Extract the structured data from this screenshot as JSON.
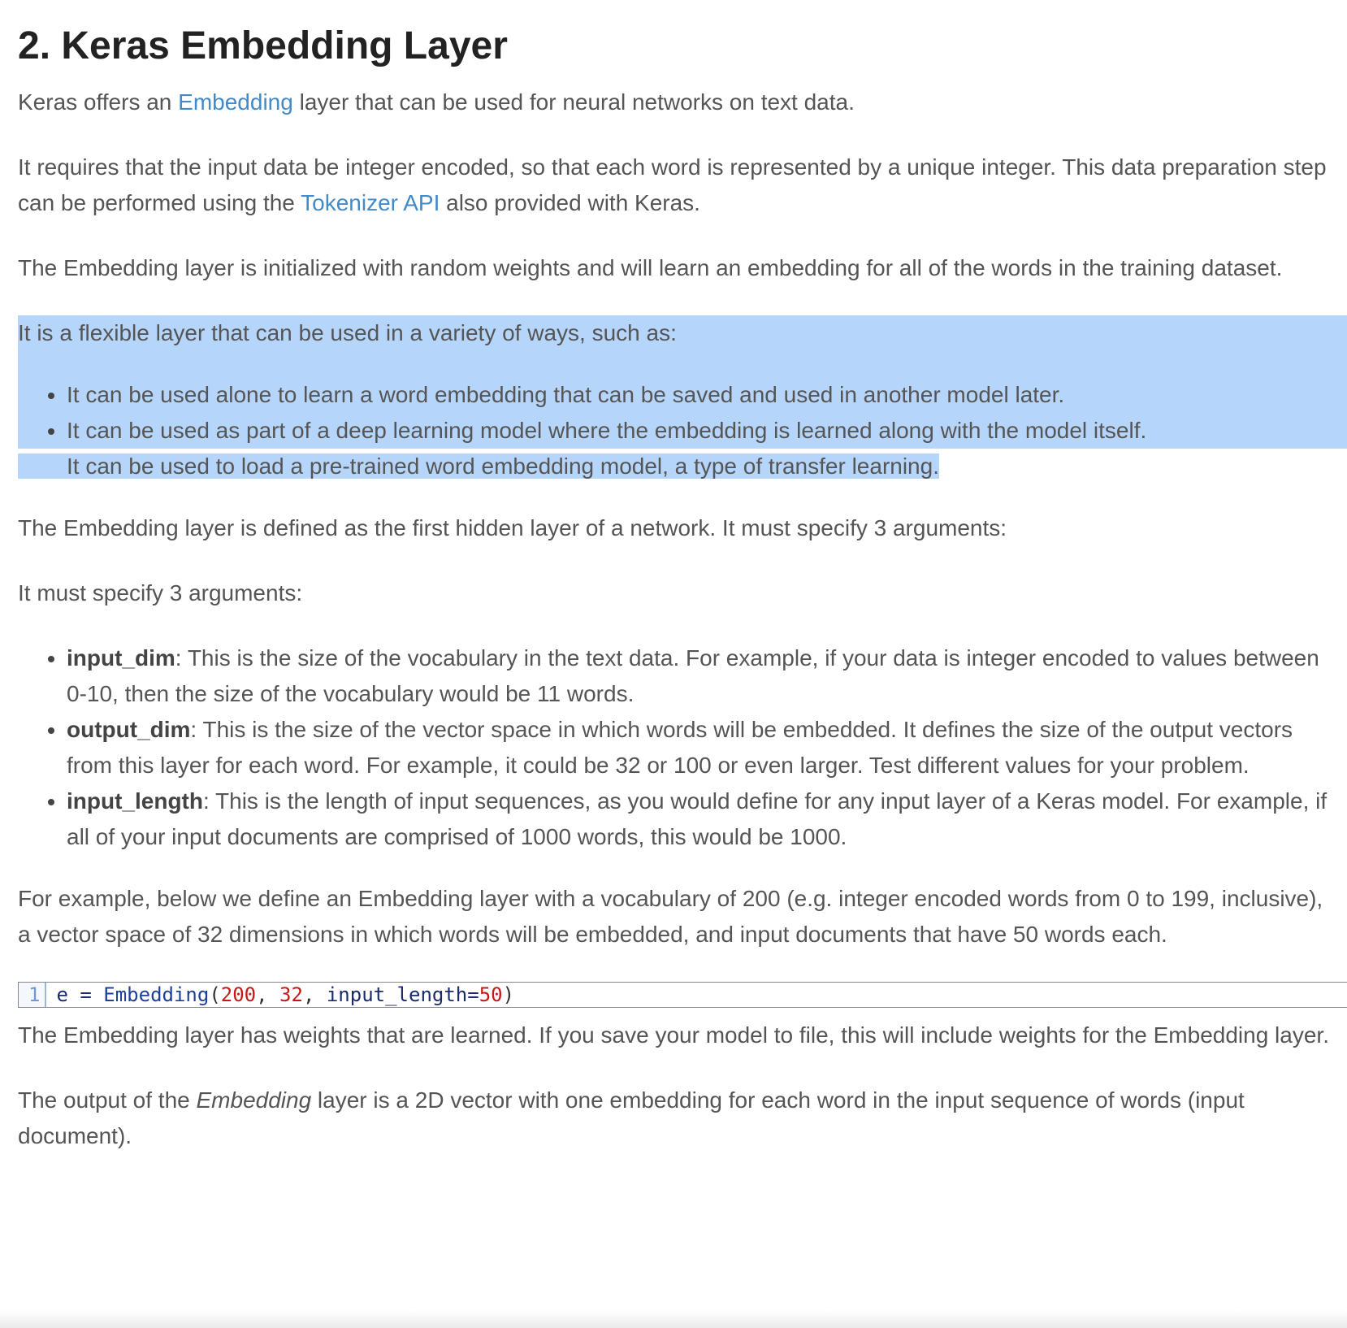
{
  "heading": "2. Keras Embedding Layer",
  "p1": {
    "before": "Keras offers an ",
    "link": "Embedding",
    "after": " layer that can be used for neural networks on text data."
  },
  "p2": {
    "before": "It requires that the input data be integer encoded, so that each word is represented by a unique integer. This data preparation step can be performed using the ",
    "link": "Tokenizer API",
    "after": " also provided with Keras."
  },
  "p3": "The Embedding layer is initialized with random weights and will learn an embedding for all of the words in the training dataset.",
  "p4": "It is a flexible layer that can be used in a variety of ways, such as:",
  "uses": [
    "It can be used alone to learn a word embedding that can be saved and used in another model later.",
    "It can be used as part of a deep learning model where the embedding is learned along with the model itself.",
    "It can be used to load a pre-trained word embedding model, a type of transfer learning."
  ],
  "p5": "The Embedding layer is defined as the first hidden layer of a network. It must specify 3 arguments:",
  "p6": "It must specify 3 arguments:",
  "arguments": [
    {
      "name": "input_dim",
      "desc": ": This is the size of the vocabulary in the text data. For example, if your data is integer encoded to values between 0-10, then the size of the vocabulary would be 11 words."
    },
    {
      "name": "output_dim",
      "desc": ": This is the size of the vector space in which words will be embedded. It defines the size of the output vectors from this layer for each word. For example, it could be 32 or 100 or even larger. Test different values for your problem."
    },
    {
      "name": "input_length",
      "desc": ": This is the length of input sequences, as you would define for any input layer of a Keras model. For example, if all of your input documents are comprised of 1000 words, this would be 1000."
    }
  ],
  "p7": "For example, below we define an Embedding layer with a vocabulary of 200 (e.g. integer encoded words from 0 to 199, inclusive), a vector space of 32 dimensions in which words will be embedded, and input documents that have 50 words each.",
  "code": {
    "line_number": "1",
    "var": "e",
    "eq": " = ",
    "func": "Embedding",
    "open": "(",
    "arg1": "200",
    "sep1": ", ",
    "arg2": "32",
    "sep2": ", ",
    "kw": "input_length",
    "kw_eq": "=",
    "arg3": "50",
    "close": ")"
  },
  "p8": "The Embedding layer has weights that are learned. If you save your model to file, this will include weights for the Embedding layer.",
  "p9": {
    "before": "The output of the ",
    "em": "Embedding",
    "after": " layer is a 2D vector with one embedding for each word in the input sequence of words (input document)."
  },
  "colors": {
    "text": "#555555",
    "heading": "#222222",
    "link": "#428bca",
    "selection": "#b6d5fa",
    "code_number": "#c41a16"
  }
}
